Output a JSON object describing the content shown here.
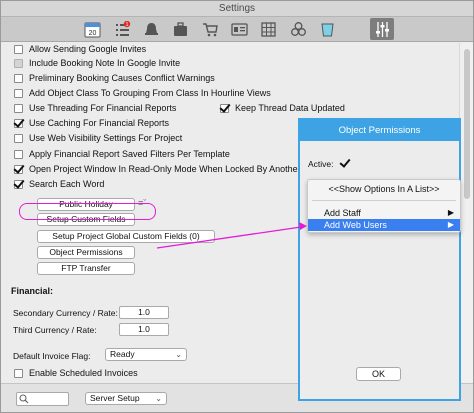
{
  "window": {
    "title": "Settings"
  },
  "toolbar": {
    "icons": [
      {
        "name": "calendar-icon",
        "badge": "20"
      },
      {
        "name": "task-list-icon",
        "badge": "1"
      },
      {
        "name": "bell-icon"
      },
      {
        "name": "briefcase-icon"
      },
      {
        "name": "cart-icon"
      },
      {
        "name": "id-card-icon"
      },
      {
        "name": "grid-icon"
      },
      {
        "name": "circles-icon"
      },
      {
        "name": "cup-icon"
      },
      {
        "name": "sliders-icon",
        "active": true
      }
    ]
  },
  "options": [
    {
      "label": "Allow Sending Google Invites",
      "checked": false,
      "dim": false
    },
    {
      "label": "Include Booking Note In Google Invite",
      "checked": false,
      "dim": true
    },
    {
      "label": "Preliminary Booking Causes Conflict Warnings",
      "checked": false,
      "dim": false
    },
    {
      "label": "Add Object Class To Grouping From Class In Hourline Views",
      "checked": false,
      "dim": false
    },
    {
      "label": "Use Threading For Financial Reports",
      "checked": false,
      "dim": false
    },
    {
      "label": "Use Caching For Financial Reports",
      "checked": true,
      "dim": false
    },
    {
      "label": "Use Web Visibility Settings For Project",
      "checked": false,
      "dim": false
    },
    {
      "label": "Apply Financial Report Saved Filters Per Template",
      "checked": false,
      "dim": false
    },
    {
      "label": "Open Project Window In Read-Only Mode When Locked By Another User",
      "checked": true,
      "dim": false
    },
    {
      "label": "Search Each Word",
      "checked": true,
      "dim": false
    }
  ],
  "keep_thread": {
    "label": "Keep Thread Data Updated",
    "checked": true
  },
  "buttons": {
    "public_holiday": "Public Holiday",
    "setup_custom_fields": "Setup Custom Fields",
    "setup_project_global": "Setup Project Global Custom Fields (0)",
    "object_permissions": "Object Permissions",
    "ftp_transfer": "FTP Transfer",
    "menu_arrows": "≡ˇ"
  },
  "financial": {
    "heading": "Financial:",
    "secondary_label": "Secondary Currency / Rate:",
    "secondary_value": "1.0",
    "third_label": "Third Currency / Rate:",
    "third_value": "1.0"
  },
  "invoice": {
    "label": "Default Invoice Flag:",
    "value": "Ready",
    "partial_label": "Enable Scheduled Invoices"
  },
  "bottom": {
    "search_placeholder": "",
    "server_setup": "Server Setup"
  },
  "panel": {
    "title": "Object Permissions",
    "active_label": "Active:",
    "active_checked": true,
    "ok_label": "OK"
  },
  "popup": {
    "header": "<<Show Options In A List>>",
    "items": [
      {
        "label": "Add Staff",
        "selected": false
      },
      {
        "label": "Add Web Users",
        "selected": true
      }
    ]
  },
  "colors": {
    "accent": "#3ea3e5",
    "highlight": "#e21cd8",
    "selection": "#3a7ff0"
  }
}
